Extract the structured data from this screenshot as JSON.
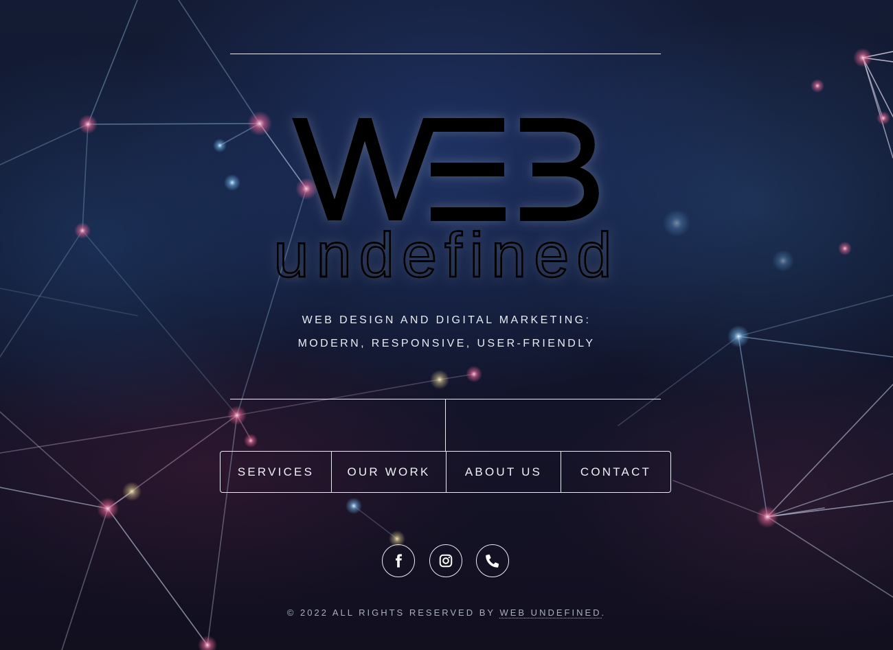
{
  "brand": {
    "word_top": "WEB",
    "word_bottom": "undefined"
  },
  "tagline": {
    "line1": "WEB DESIGN AND DIGITAL MARKETING:",
    "line2": "MODERN, RESPONSIVE, USER-FRIENDLY"
  },
  "nav": {
    "items": [
      {
        "label": "SERVICES"
      },
      {
        "label": "OUR WORK"
      },
      {
        "label": "ABOUT US"
      },
      {
        "label": "CONTACT"
      }
    ]
  },
  "social": [
    {
      "icon": "facebook-icon"
    },
    {
      "icon": "instagram-icon"
    },
    {
      "icon": "phone-icon"
    }
  ],
  "footer": {
    "prefix": "© 2022 ALL RIGHTS RESERVED BY ",
    "link": "WEB UNDEFINED",
    "suffix": "."
  },
  "colors": {
    "background": "#101830",
    "line": "#e8ecf5",
    "text": "#eef1f7",
    "footer_text": "#a9afc0",
    "logo_fill": "#000000"
  }
}
